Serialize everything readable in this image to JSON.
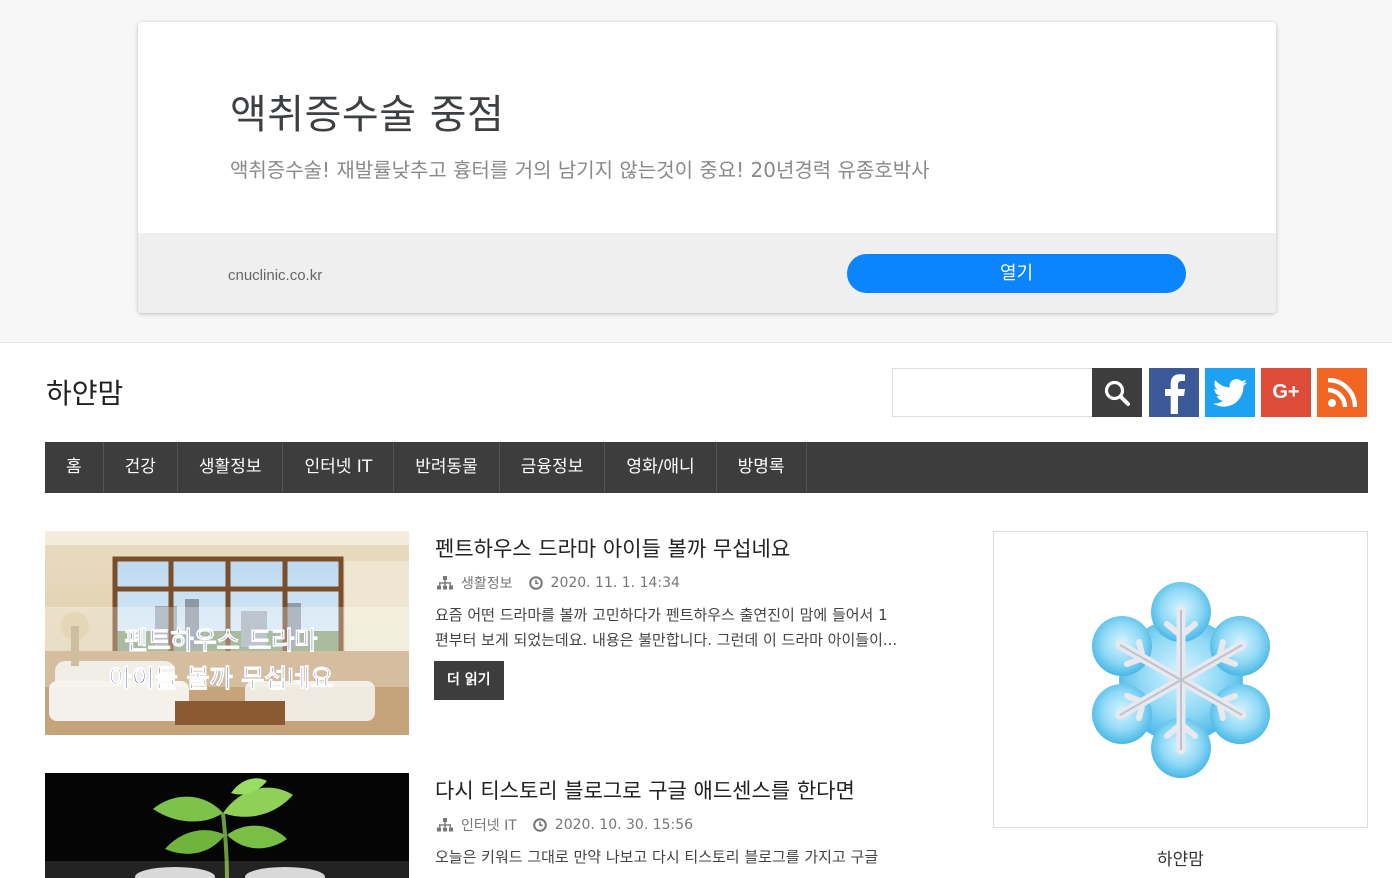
{
  "ad": {
    "title": "액취증수술 중점",
    "description": "액취증수술! 재발률낮추고 흉터를 거의 남기지 않는것이 중요! 20년경력 유종호박사",
    "url": "cnuclinic.co.kr",
    "open_label": "열기",
    "button_color": "#0a84ff"
  },
  "header": {
    "site_title": "하얀맘",
    "search_placeholder": "",
    "icons": [
      "search-icon",
      "facebook-icon",
      "twitter-icon",
      "google-plus-icon",
      "rss-icon"
    ],
    "gplus_label": "G+"
  },
  "nav": {
    "items": [
      "홈",
      "건강",
      "생활정보",
      "인터넷 IT",
      "반려동물",
      "금융정보",
      "영화/애니",
      "방명록"
    ]
  },
  "posts": [
    {
      "title": "펜트하우스 드라마 아이들 볼까 무섭네요",
      "category": "생활정보",
      "date": "2020. 11. 1. 14:34",
      "excerpt_line1": "요즘 어떤 드라마를 볼까 고민하다가 펜트하우스 출연진이 맘에 들어서 1",
      "excerpt_line2": "편부터 보게 되었는데요. 내용은 불만합니다. 그런데 이 드라마 아이들이...",
      "read_more": "더 읽기",
      "thumb_caption_line1": "펜트하우스 드라마",
      "thumb_caption_line2": "아이들 볼까 무섭네요"
    },
    {
      "title": "다시 티스토리 블로그로 구글 애드센스를 한다면",
      "category": "인터넷 IT",
      "date": "2020. 10. 30. 15:56",
      "excerpt_line1": "오늘은 키워드 그대로 만약 나보고 다시 티스토리 블로그를 가지고 구글"
    }
  ],
  "sidebar": {
    "profile_name": "하얀맘"
  },
  "colors": {
    "nav_bg": "#3d3d3d",
    "facebook": "#3b5998",
    "twitter": "#1da1f2",
    "google_plus": "#dd4b39",
    "rss": "#f26522"
  }
}
